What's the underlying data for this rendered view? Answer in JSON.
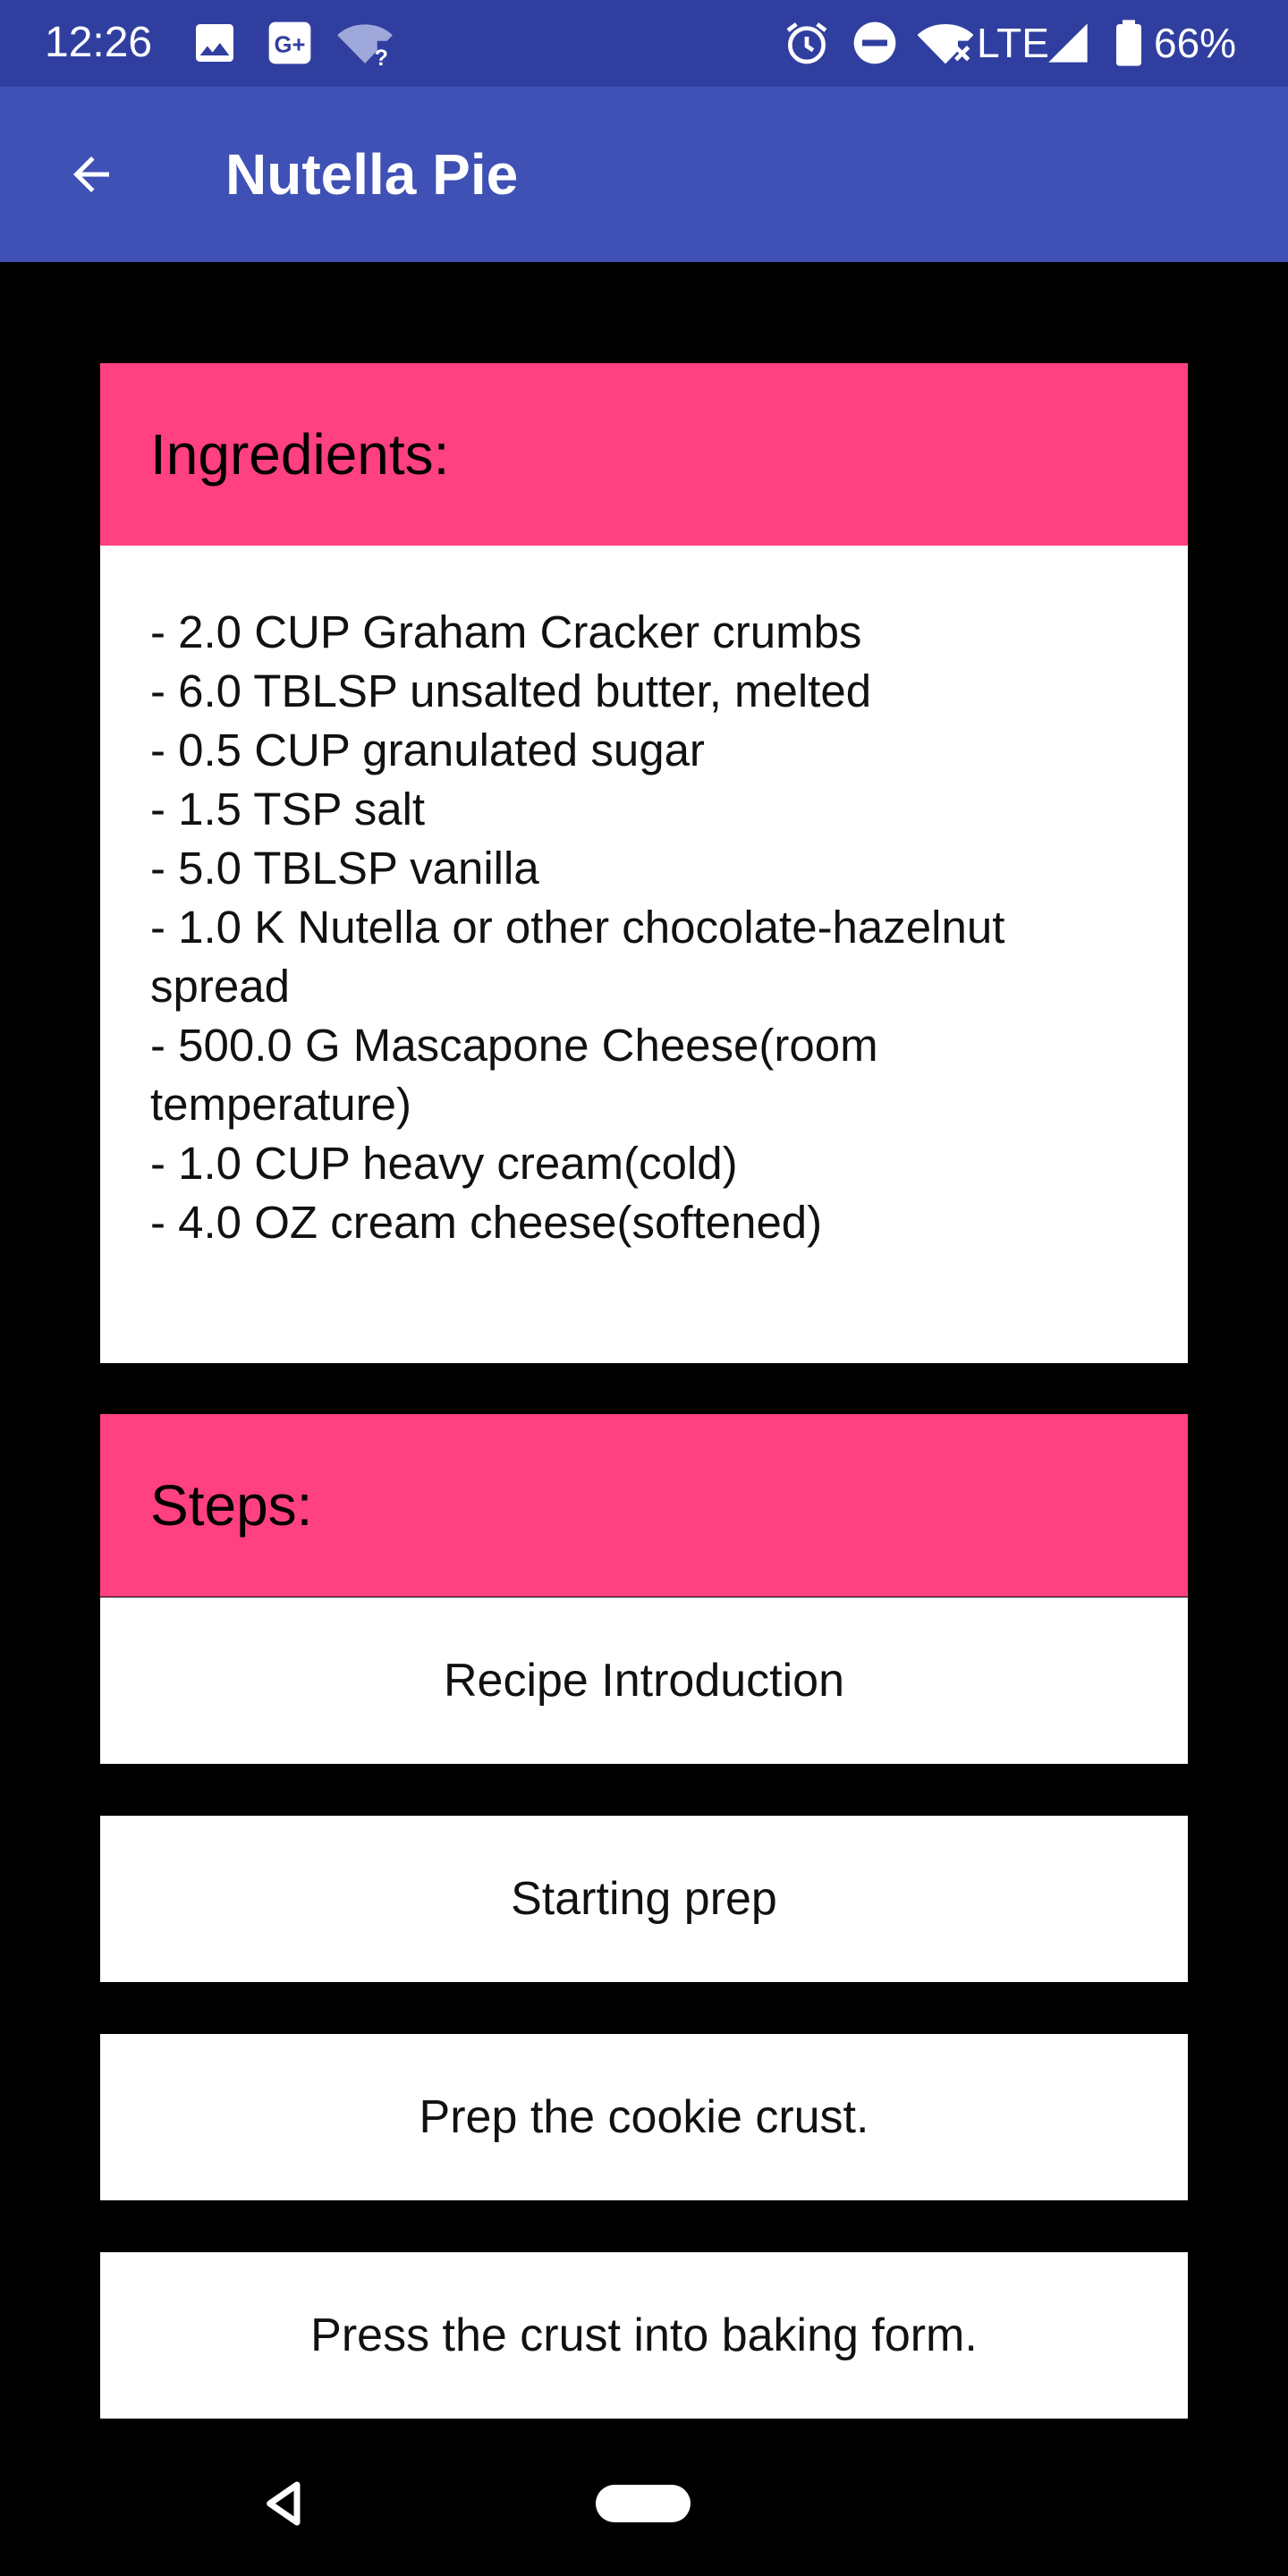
{
  "status_bar": {
    "time": "12:26",
    "network": "LTE",
    "battery": "66%",
    "icons": [
      "image-icon",
      "google-plus-icon",
      "wifi-question-icon",
      "alarm-icon",
      "do-not-disturb-icon",
      "wifi-off-icon",
      "signal-icon",
      "battery-icon"
    ],
    "background_color": "#303f9f"
  },
  "app_bar": {
    "title": "Nutella Pie",
    "back_icon": "arrow-back-icon",
    "background_color": "#3f51b5"
  },
  "ingredients": {
    "header": "Ingredients:",
    "header_color": "#ff4081",
    "items": [
      "- 2.0 CUP Graham Cracker crumbs",
      "- 6.0 TBLSP unsalted butter, melted",
      "- 0.5 CUP granulated sugar",
      "- 1.5 TSP salt",
      "- 5.0 TBLSP vanilla",
      "- 1.0 K Nutella or other chocolate-hazelnut spread",
      "- 500.0 G Mascapone Cheese(room temperature)",
      "- 1.0 CUP heavy cream(cold)",
      "- 4.0 OZ cream cheese(softened)"
    ]
  },
  "steps": {
    "header": "Steps:",
    "items": [
      "Recipe Introduction",
      "Starting prep",
      "Prep the cookie crust.",
      "Press the crust into baking form."
    ]
  },
  "nav_bar": {
    "back_icon": "nav-back-triangle-icon",
    "home_icon": "nav-home-pill-icon"
  }
}
